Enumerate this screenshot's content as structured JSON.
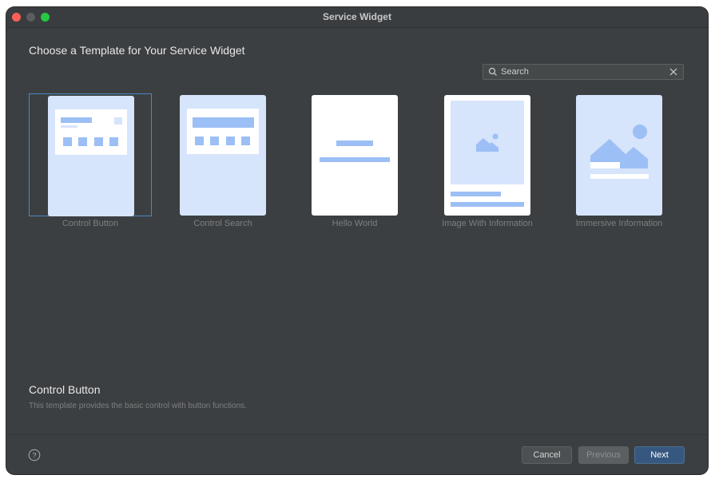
{
  "window": {
    "title": "Service Widget"
  },
  "heading": "Choose a Template for Your Service Widget",
  "search": {
    "placeholder": "Search"
  },
  "templates": [
    {
      "label": "Control Button",
      "selected": true
    },
    {
      "label": "Control Search",
      "selected": false
    },
    {
      "label": "Hello World",
      "selected": false
    },
    {
      "label": "Image With Information",
      "selected": false
    },
    {
      "label": "Immersive Information",
      "selected": false
    }
  ],
  "description": {
    "title": "Control Button",
    "text": "This template provides the basic control with button functions."
  },
  "footer": {
    "cancel_label": "Cancel",
    "previous_label": "Previous",
    "next_label": "Next"
  },
  "colors": {
    "background": "#3c3f41",
    "selection_border": "#4a88c7",
    "thumb_light": "#d6e4fc",
    "thumb_accent": "#9cbff5",
    "primary_button": "#365880"
  },
  "icons": {
    "search": "search-icon",
    "clear": "close-icon",
    "help": "question-circle-icon"
  }
}
